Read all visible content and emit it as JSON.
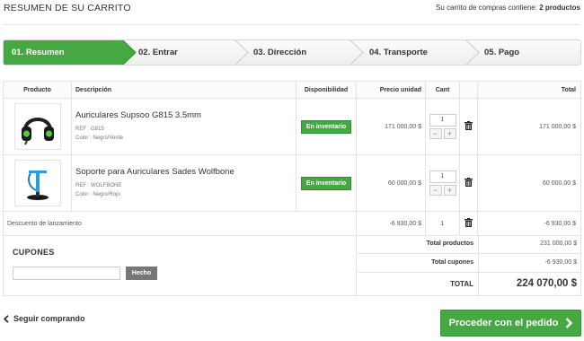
{
  "header": {
    "title": "RESUMEN DE SU CARRITO",
    "count_prefix": "Su carrito de compras contiene:",
    "count_value": "2 productos"
  },
  "steps": [
    {
      "label": "01. Resumen",
      "active": true
    },
    {
      "label": "02. Entrar",
      "active": false
    },
    {
      "label": "03. Dirección",
      "active": false
    },
    {
      "label": "04. Transporte",
      "active": false
    },
    {
      "label": "05. Pago",
      "active": false
    }
  ],
  "colors": {
    "accent": "#45a843",
    "text": "#333333",
    "border": "#e3e3e3"
  },
  "table": {
    "headers": {
      "product": "Producto",
      "description": "Descripción",
      "availability": "Disponibilidad",
      "unit_price": "Precio unidad",
      "qty": "Cant",
      "total": "Total"
    },
    "items": [
      {
        "name": "Auriculares Supsoo G815 3.5mm",
        "ref": "REF : G815",
        "color": "Color : Negro/Verde",
        "availability": "En inventario",
        "unit_price": "171 000,00 $",
        "qty": "1",
        "total": "171 000,00 $",
        "image_icon": "headphones-icon"
      },
      {
        "name": "Soporte para Auriculares Sades Wolfbone",
        "ref": "REF : WOLFBONE",
        "color": "Color : Negro/Rojo",
        "availability": "En inventario",
        "unit_price": "60 000,00 $",
        "qty": "1",
        "total": "60 000,00 $",
        "image_icon": "headphone-stand-icon"
      }
    ],
    "discount": {
      "label": "Descuento de lanzamiento",
      "unit_price": "-6 930,00 $",
      "qty": "1",
      "total": "-6 930,00 $"
    }
  },
  "coupons": {
    "title": "CUPONES",
    "input_value": "",
    "button_label": "Hecho"
  },
  "summary": {
    "products_label": "Total productos",
    "products_value": "231 000,00 $",
    "coupons_label": "Total cupones",
    "coupons_value": "-6 930,00 $",
    "total_label": "TOTAL",
    "total_value": "224 070,00 $"
  },
  "footer": {
    "continue_label": "Seguir comprando",
    "proceed_label": "Proceder con el pedido"
  }
}
